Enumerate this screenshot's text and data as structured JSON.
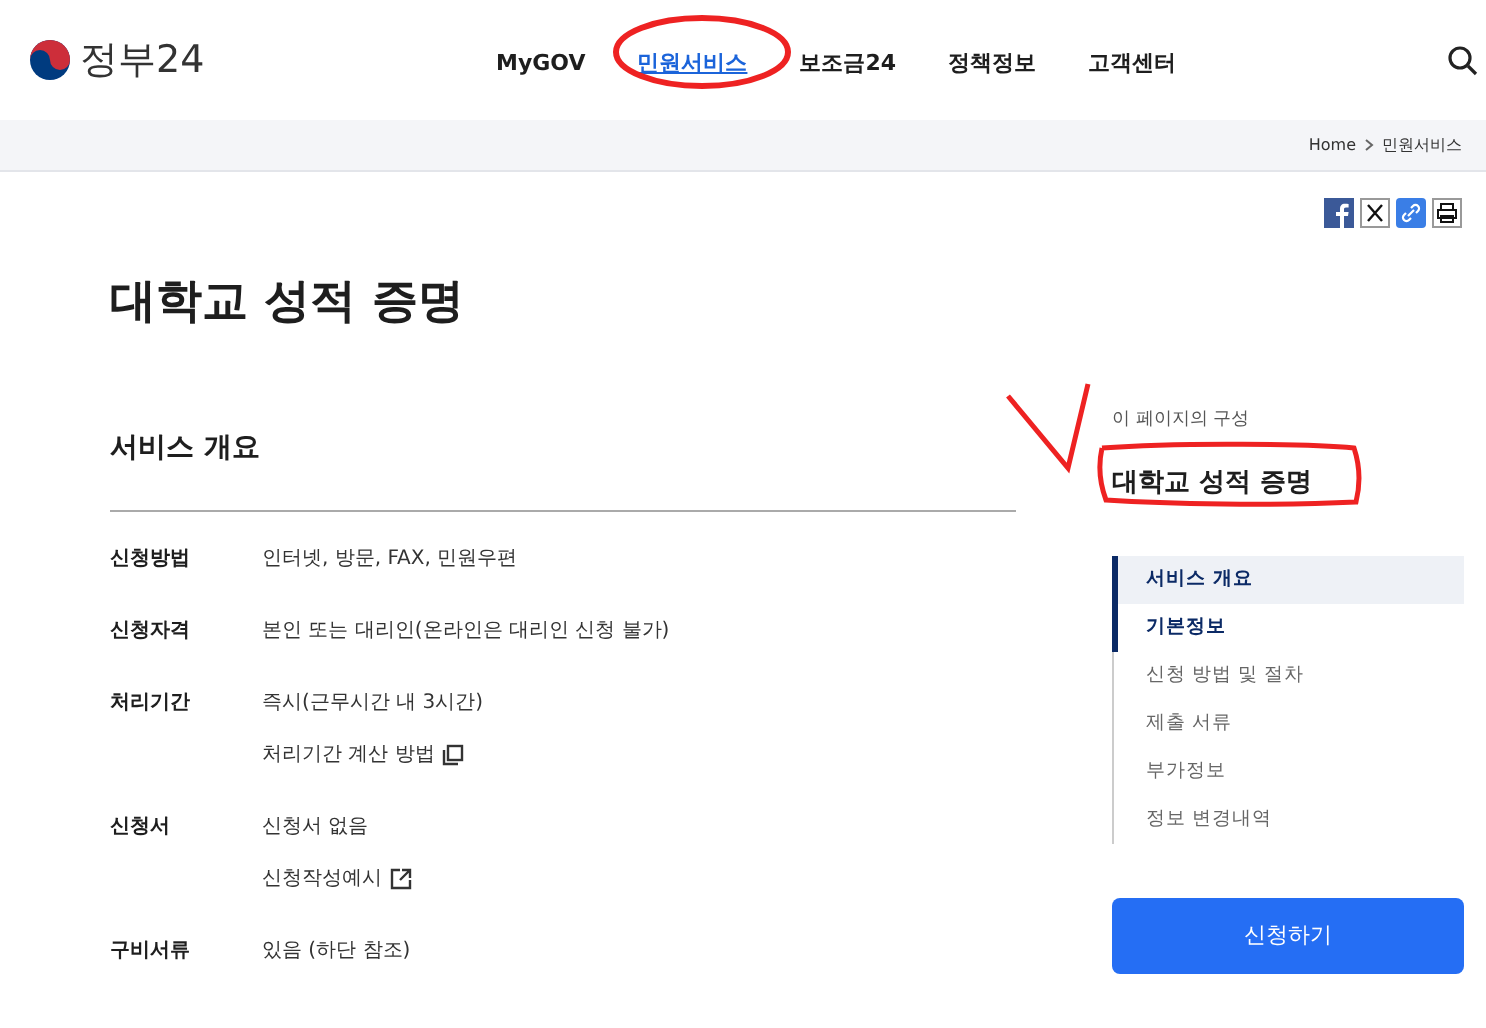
{
  "logo": {
    "text": "정부24"
  },
  "nav": [
    {
      "label": "MyGOV",
      "selected": false
    },
    {
      "label": "민원서비스",
      "selected": true
    },
    {
      "label": "보조금24",
      "selected": false
    },
    {
      "label": "정책정보",
      "selected": false
    },
    {
      "label": "고객센터",
      "selected": false
    }
  ],
  "breadcrumb": [
    "Home",
    "민원서비스"
  ],
  "page_title": "대학교 성적 증명",
  "section_title": "서비스 개요",
  "details": [
    {
      "label": "신청방법",
      "values": [
        {
          "text": "인터넷, 방문, FAX, 민원우편",
          "kind": "plain"
        }
      ]
    },
    {
      "label": "신청자격",
      "values": [
        {
          "text": "본인 또는 대리인(온라인은 대리인 신청 불가)",
          "kind": "plain"
        }
      ]
    },
    {
      "label": "처리기간",
      "values": [
        {
          "text": "즉시(근무시간 내 3시간)",
          "kind": "plain"
        },
        {
          "text": "처리기간 계산 방법",
          "kind": "popup"
        }
      ]
    },
    {
      "label": "신청서",
      "values": [
        {
          "text": "신청서 없음",
          "kind": "plain"
        },
        {
          "text": "신청작성예시",
          "kind": "external"
        }
      ]
    },
    {
      "label": "구비서류",
      "values": [
        {
          "text": "있음 (하단 참조)",
          "kind": "plain"
        }
      ]
    }
  ],
  "toc": {
    "caption": "이 페이지의 구성",
    "title": "대학교 성적 증명",
    "items": [
      {
        "label": "서비스 개요",
        "selected": true,
        "active": true
      },
      {
        "label": "기본정보",
        "selected": false,
        "active": true
      },
      {
        "label": "신청 방법 및 절차",
        "selected": false,
        "active": false
      },
      {
        "label": "제출 서류",
        "selected": false,
        "active": false
      },
      {
        "label": "부가정보",
        "selected": false,
        "active": false
      },
      {
        "label": "정보 변경내역",
        "selected": false,
        "active": false
      }
    ]
  },
  "apply_button": "신청하기"
}
